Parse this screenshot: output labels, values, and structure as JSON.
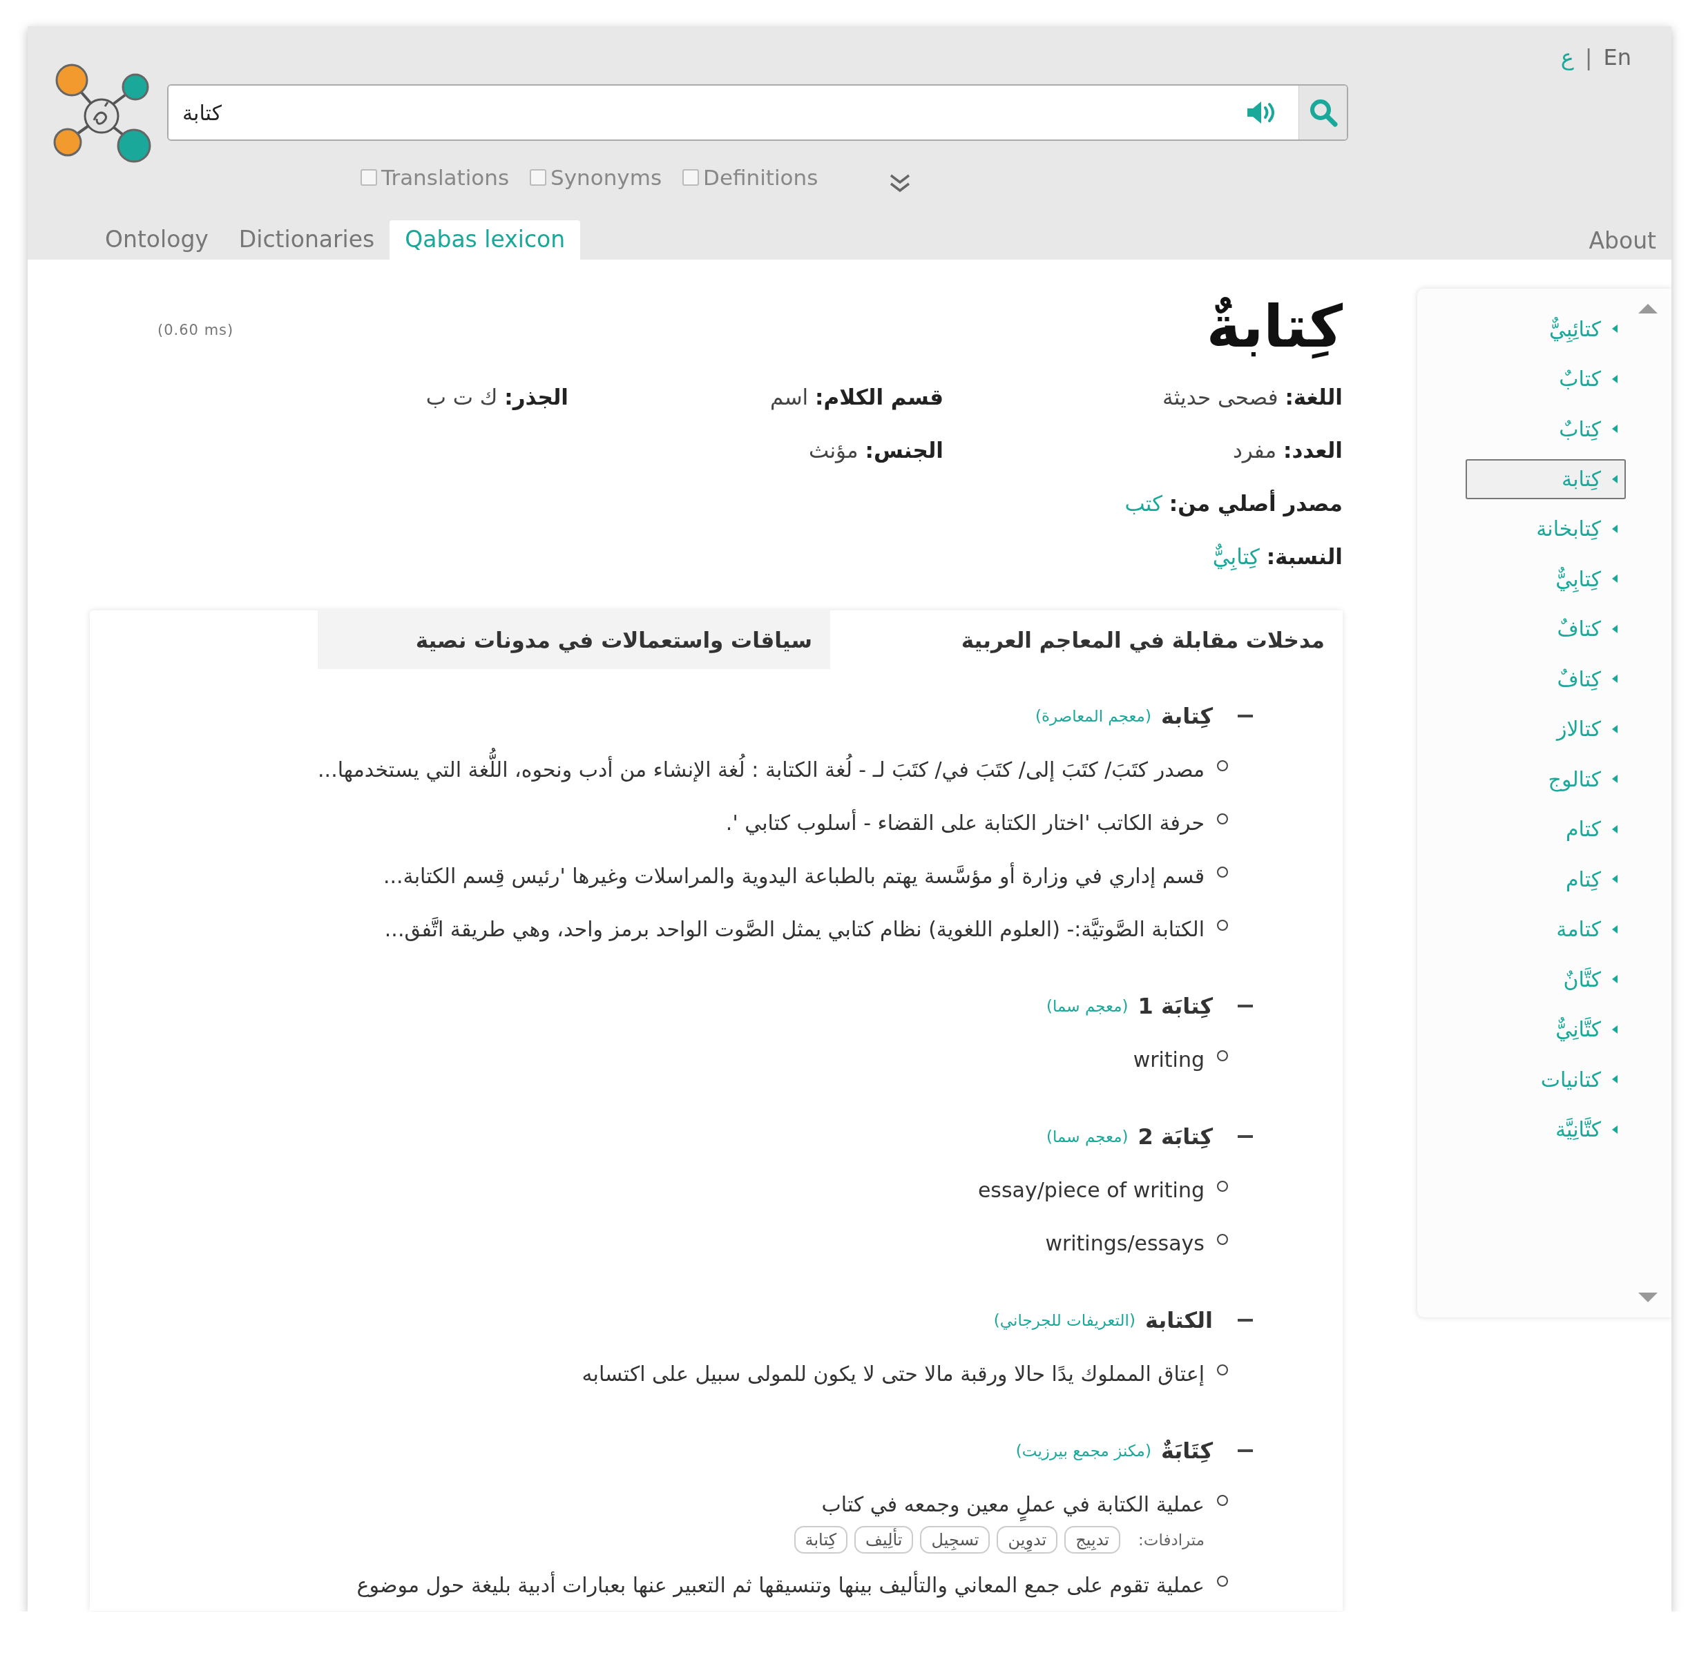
{
  "language_switch": {
    "arabic": {
      "label": "ع",
      "selected": false
    },
    "english": {
      "label": "En",
      "selected": true
    }
  },
  "language_separator": "|",
  "search": {
    "value": "كتابة"
  },
  "options": {
    "translations": {
      "label": "Translations",
      "checked": false
    },
    "synonyms": {
      "label": "Synonyms",
      "checked": false
    },
    "definitions": {
      "label": "Definitions",
      "checked": false
    }
  },
  "nav_tabs": {
    "ontology": {
      "label": "Ontology",
      "selected": false
    },
    "dictionaries": {
      "label": "Dictionaries",
      "selected": false
    },
    "qabas_lexicon": {
      "label": "Qabas lexicon",
      "selected": true
    }
  },
  "about": "About",
  "timing": "(0.60 ms)",
  "entry": {
    "headword": "كِتابةٌ",
    "property_rows": [
      [
        {
          "label": "اللغة:",
          "value": "فصحى حديثة",
          "kind": "text"
        },
        {
          "label": "قسم الكلام:",
          "value": "اسم",
          "kind": "text"
        },
        {
          "label": "الجذر:",
          "value": "ك ت ب",
          "kind": "text"
        }
      ],
      [
        {
          "label": "العدد:",
          "value": "مفرد",
          "kind": "text"
        },
        {
          "label": "الجنس:",
          "value": "مؤنث",
          "kind": "text"
        }
      ],
      [
        {
          "label": "مصدر أصلي من:",
          "value": "كتب",
          "kind": "link"
        }
      ],
      [
        {
          "label": "النسبة:",
          "value": "كِتابِيٌّ",
          "kind": "link"
        }
      ]
    ]
  },
  "content_tabs": [
    {
      "label": "مدخلات مقابلة في المعاجم العربية",
      "selected": true
    },
    {
      "label": "سياقات واستعمالات في مدونات نصية",
      "selected": false
    }
  ],
  "dictionary_entries": [
    {
      "term": "كِتابة",
      "source": "(معجم المعاصرة)",
      "senses": [
        {
          "text": "مصدر كتَبَ/ كتَبَ إلى/ كتَبَ في/ كتَبَ لـ - لُغة الكتابة : لُغة الإنشاء من أدب ونحوه، اللُّغة التي يستخدمها..."
        },
        {
          "text": "حرفة الكاتب 'اختار الكتابة على القضاء - أسلوب كتابي '."
        },
        {
          "text": "قسم إداري في وزارة أو مؤسَّسة يهتم بالطباعة اليدوية والمراسلات وغيرها 'رئيس قِسم الكتابة..."
        },
        {
          "text": "الكتابة الصَّوتيَّة:- (العلوم اللغوية) نظام كتابي يمثل الصَّوت الواحد برمز واحد، وهي طريقة اتَّفق..."
        }
      ]
    },
    {
      "term": "كِتابَة 1",
      "source": "(معجم سما)",
      "senses": [
        {
          "text": "writing"
        }
      ]
    },
    {
      "term": "كِتابَة 2",
      "source": "(معجم سما)",
      "senses": [
        {
          "text": "essay/piece of writing"
        },
        {
          "text": "writings/essays"
        }
      ]
    },
    {
      "term": "الكتابة",
      "source": "(التعريفات للجرجاني)",
      "senses": [
        {
          "text": "إعتاق المملوك يدًا حالا ورقبة مالا حتى لا يكون للمولى سبيل على اكتسابه"
        }
      ]
    },
    {
      "term": "كِتَابَةٌ",
      "source": "(مكنز مجمع بيرزيت)",
      "senses": [
        {
          "text": "عملية الكتابة في عملٍ معين وجمعه في كتاب",
          "synonyms_label": "مترادفات:",
          "synonyms": [
            "تدبِيج",
            "تدوِين",
            "تسجِيل",
            "تألِيف",
            "كِتابة"
          ]
        },
        {
          "text": "عملية تقوم على جمع المعاني والتأليف بينها وتنسيقها ثم التعبير عنها بعبارات أدبية بليغة حول موضوع"
        }
      ]
    }
  ],
  "sidebar": {
    "items": [
      {
        "label": "كتائِبِيٌّ",
        "selected": false
      },
      {
        "label": "كتابٌ",
        "selected": false
      },
      {
        "label": "كِتابٌ",
        "selected": false
      },
      {
        "label": "كِتابة",
        "selected": true
      },
      {
        "label": "كِتابخانة",
        "selected": false
      },
      {
        "label": "كِتابِيٌّ",
        "selected": false
      },
      {
        "label": "كتافٌ",
        "selected": false
      },
      {
        "label": "كِتافٌ",
        "selected": false
      },
      {
        "label": "كتالاز",
        "selected": false
      },
      {
        "label": "كتالوج",
        "selected": false
      },
      {
        "label": "كتام",
        "selected": false
      },
      {
        "label": "كِتام",
        "selected": false
      },
      {
        "label": "كتامة",
        "selected": false
      },
      {
        "label": "كتَّانٌ",
        "selected": false
      },
      {
        "label": "كتَّانِيٌّ",
        "selected": false
      },
      {
        "label": "كتانيات",
        "selected": false
      },
      {
        "label": "كتَّانِيَّة",
        "selected": false
      }
    ]
  }
}
